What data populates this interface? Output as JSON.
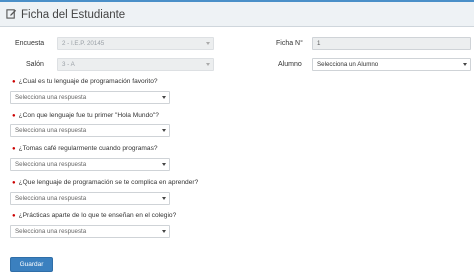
{
  "header": {
    "title": "Ficha del Estudiante"
  },
  "form": {
    "encuesta_label": "Encuesta",
    "encuesta_value": "2 - I.E.P. 20145",
    "ficha_label": "Ficha N°",
    "ficha_value": "1",
    "salon_label": "Salón",
    "salon_value": "3 - A",
    "alumno_label": "Alumno",
    "alumno_value": "Selecciona un Alumno"
  },
  "questions": [
    {
      "text": "¿Cual es tu lenguaje de programación favorito?",
      "placeholder": "Selecciona una respuesta"
    },
    {
      "text": "¿Con que lenguaje fue tu primer \"Hola Mundo\"?",
      "placeholder": "Selecciona una respuesta"
    },
    {
      "text": "¿Tomas café regularmente cuando programas?",
      "placeholder": "Selecciona una respuesta"
    },
    {
      "text": "¿Que lenguaje de programación se te complica en aprender?",
      "placeholder": "Selecciona una respuesta"
    },
    {
      "text": "¿Prácticas aparte de lo que te enseñan en el colegio?",
      "placeholder": "Selecciona una respuesta"
    }
  ],
  "actions": {
    "save_label": "Guardar"
  }
}
